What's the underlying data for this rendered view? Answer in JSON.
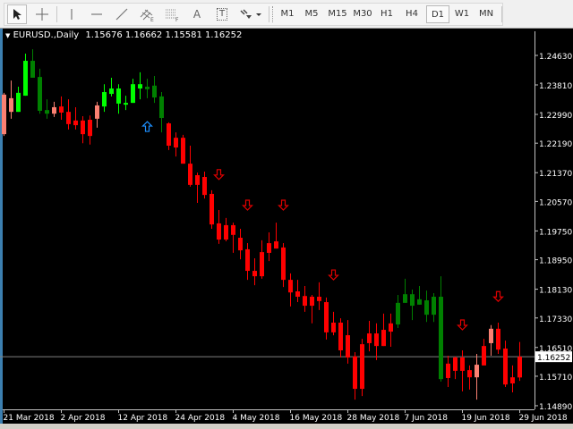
{
  "toolbar": {
    "tools": [
      {
        "name": "cursor-icon"
      },
      {
        "name": "crosshair-icon"
      },
      {
        "name": "vertical-line-icon"
      },
      {
        "name": "horizontal-line-icon"
      },
      {
        "name": "trendline-icon"
      },
      {
        "name": "equidistant-channel-icon"
      },
      {
        "name": "fibonacci-icon"
      },
      {
        "name": "text-icon",
        "label": "A"
      },
      {
        "name": "text-label-icon",
        "label": "T"
      },
      {
        "name": "arrows-icon"
      }
    ],
    "timeframes": [
      "M1",
      "M5",
      "M15",
      "M30",
      "H1",
      "H4",
      "D1",
      "W1",
      "MN"
    ],
    "active_timeframe": "D1"
  },
  "chart": {
    "symbol": "EURUSD.,Daily",
    "ohlc": "1.15676 1.16662 1.15581 1.16252",
    "current_price": "1.16252",
    "colors": {
      "lime": "#00ff00",
      "dgreen": "#008000",
      "red": "#ff0000",
      "salmon": "#fa8072",
      "arrow_up": "#1e90ff",
      "arrow_down": "#e00000",
      "price_line": "#808080"
    }
  },
  "chart_data": {
    "type": "candlestick",
    "title": "EURUSD.,Daily",
    "ylim": [
      1.1475,
      1.254
    ],
    "y_ticks": [
      "1.24630",
      "1.23810",
      "1.22990",
      "1.22190",
      "1.21370",
      "1.20570",
      "1.19750",
      "1.18950",
      "1.18130",
      "1.17330",
      "1.16510",
      "1.15710",
      "1.14890"
    ],
    "x_ticks": [
      {
        "bar": 0,
        "label": "21 Mar 2018"
      },
      {
        "bar": 8,
        "label": "2 Apr 2018"
      },
      {
        "bar": 16,
        "label": "12 Apr 2018"
      },
      {
        "bar": 24,
        "label": "24 Apr 2018"
      },
      {
        "bar": 32,
        "label": "4 May 2018"
      },
      {
        "bar": 40,
        "label": "16 May 2018"
      },
      {
        "bar": 48,
        "label": "28 May 2018"
      },
      {
        "bar": 56,
        "label": "7 Jun 2018"
      },
      {
        "bar": 64,
        "label": "19 Jun 2018"
      },
      {
        "bar": 72,
        "label": "29 Jun 2018"
      }
    ],
    "candles": [
      [
        1.2244,
        1.2359,
        1.2239,
        1.2354,
        "salmon"
      ],
      [
        1.2306,
        1.2393,
        1.2287,
        1.2344,
        "salmon"
      ],
      [
        1.2306,
        1.2376,
        1.2306,
        1.2359,
        "lime"
      ],
      [
        1.2351,
        1.2468,
        1.2351,
        1.2448,
        "lime"
      ],
      [
        1.2448,
        1.248,
        1.2401,
        1.2401,
        "dgreen"
      ],
      [
        1.2403,
        1.2426,
        1.2301,
        1.2309,
        "dgreen"
      ],
      [
        1.2311,
        1.2341,
        1.2287,
        1.2301,
        "dgreen"
      ],
      [
        1.2301,
        1.2334,
        1.2292,
        1.2319,
        "salmon"
      ],
      [
        1.2321,
        1.2349,
        1.2284,
        1.2304,
        "red"
      ],
      [
        1.2306,
        1.2341,
        1.2257,
        1.2272,
        "red"
      ],
      [
        1.2282,
        1.2319,
        1.2257,
        1.2269,
        "red"
      ],
      [
        1.2282,
        1.2294,
        1.2219,
        1.2244,
        "red"
      ],
      [
        1.2284,
        1.2296,
        1.2215,
        1.2239,
        "red"
      ],
      [
        1.2287,
        1.2334,
        1.2262,
        1.2324,
        "salmon"
      ],
      [
        1.2321,
        1.2383,
        1.2306,
        1.2361,
        "lime"
      ],
      [
        1.2356,
        1.2401,
        1.2349,
        1.2371,
        "lime"
      ],
      [
        1.2329,
        1.2383,
        1.2301,
        1.2371,
        "lime"
      ],
      [
        1.2326,
        1.2351,
        1.2311,
        1.2331,
        "lime"
      ],
      [
        1.2331,
        1.2398,
        1.2331,
        1.2383,
        "lime"
      ],
      [
        1.2371,
        1.2416,
        1.2341,
        1.2383,
        "lime"
      ],
      [
        1.2376,
        1.2398,
        1.2344,
        1.2369,
        "dgreen"
      ],
      [
        1.2379,
        1.2406,
        1.2331,
        1.2346,
        "dgreen"
      ],
      [
        1.2349,
        1.2361,
        1.2249,
        1.2289,
        "dgreen"
      ],
      [
        1.2274,
        1.2277,
        1.22,
        1.2212,
        "red"
      ],
      [
        1.2234,
        1.2249,
        1.2182,
        1.2207,
        "red"
      ],
      [
        1.2234,
        1.2242,
        1.2162,
        1.2162,
        "red"
      ],
      [
        1.2162,
        1.2212,
        1.2098,
        1.2103,
        "red"
      ],
      [
        1.213,
        1.2137,
        1.2053,
        1.2103,
        "red"
      ],
      [
        1.2125,
        1.214,
        1.2065,
        1.2075,
        "red"
      ],
      [
        1.2078,
        1.2088,
        1.1981,
        1.1993,
        "red"
      ],
      [
        1.1996,
        1.2033,
        1.1939,
        1.1951,
        "red"
      ],
      [
        1.1991,
        1.2011,
        1.1946,
        1.1951,
        "red"
      ],
      [
        1.1991,
        1.1998,
        1.1914,
        1.1964,
        "red"
      ],
      [
        1.1956,
        1.1981,
        1.1896,
        1.1921,
        "red"
      ],
      [
        1.1924,
        1.1941,
        1.1839,
        1.1864,
        "red"
      ],
      [
        1.1864,
        1.1899,
        1.1824,
        1.1849,
        "red"
      ],
      [
        1.1916,
        1.1949,
        1.1842,
        1.1849,
        "red"
      ],
      [
        1.1941,
        1.1971,
        1.1891,
        1.1914,
        "red"
      ],
      [
        1.1946,
        1.1998,
        1.1926,
        1.1926,
        "red"
      ],
      [
        1.1929,
        1.1941,
        1.1819,
        1.1839,
        "red"
      ],
      [
        1.1839,
        1.1857,
        1.1765,
        1.1804,
        "red"
      ],
      [
        1.1807,
        1.1839,
        1.1777,
        1.1792,
        "red"
      ],
      [
        1.1794,
        1.1822,
        1.175,
        1.1767,
        "red"
      ],
      [
        1.1792,
        1.1797,
        1.1718,
        1.1767,
        "red"
      ],
      [
        1.1792,
        1.1832,
        1.1755,
        1.178,
        "red"
      ],
      [
        1.1777,
        1.179,
        1.1673,
        1.1693,
        "red"
      ],
      [
        1.172,
        1.175,
        1.1685,
        1.1693,
        "red"
      ],
      [
        1.172,
        1.1732,
        1.1623,
        1.1643,
        "red"
      ],
      [
        1.1685,
        1.1727,
        1.1606,
        1.1623,
        "red"
      ],
      [
        1.1626,
        1.1638,
        1.1506,
        1.1536,
        "red"
      ],
      [
        1.166,
        1.1675,
        1.1516,
        1.1536,
        "red"
      ],
      [
        1.169,
        1.1725,
        1.164,
        1.1663,
        "red"
      ],
      [
        1.169,
        1.1718,
        1.1616,
        1.1655,
        "red"
      ],
      [
        1.17,
        1.1745,
        1.1655,
        1.1655,
        "red"
      ],
      [
        1.1718,
        1.1745,
        1.1653,
        1.1695,
        "red"
      ],
      [
        1.1775,
        1.1797,
        1.1705,
        1.1715,
        "dgreen"
      ],
      [
        1.1799,
        1.1842,
        1.1775,
        1.1775,
        "dgreen"
      ],
      [
        1.1799,
        1.1812,
        1.1727,
        1.1767,
        "dgreen"
      ],
      [
        1.1785,
        1.1822,
        1.177,
        1.177,
        "dgreen"
      ],
      [
        1.1782,
        1.1809,
        1.1722,
        1.1742,
        "dgreen"
      ],
      [
        1.1792,
        1.1802,
        1.1722,
        1.1742,
        "dgreen"
      ],
      [
        1.1792,
        1.1849,
        1.1556,
        1.1563,
        "dgreen"
      ],
      [
        1.1606,
        1.1628,
        1.1541,
        1.1566,
        "red"
      ],
      [
        1.1623,
        1.1626,
        1.1563,
        1.1586,
        "red"
      ],
      [
        1.1623,
        1.1643,
        1.1529,
        1.1586,
        "red"
      ],
      [
        1.1588,
        1.1601,
        1.1534,
        1.1568,
        "red"
      ],
      [
        1.1568,
        1.1633,
        1.1506,
        1.1603,
        "salmon"
      ],
      [
        1.1655,
        1.1675,
        1.1601,
        1.1601,
        "red"
      ],
      [
        1.1663,
        1.1713,
        1.1628,
        1.1703,
        "salmon"
      ],
      [
        1.1703,
        1.172,
        1.1633,
        1.1645,
        "red"
      ],
      [
        1.1648,
        1.167,
        1.1541,
        1.1548,
        "red"
      ],
      [
        1.1568,
        1.1601,
        1.1526,
        1.1551,
        "red"
      ],
      [
        1.15676,
        1.16662,
        1.15581,
        1.16252,
        "red"
      ]
    ],
    "arrows": [
      {
        "bar": 20,
        "price": 1.2264,
        "dir": "up"
      },
      {
        "bar": 30,
        "price": 1.2133,
        "dir": "down"
      },
      {
        "bar": 34,
        "price": 1.2048,
        "dir": "down"
      },
      {
        "bar": 39,
        "price": 1.2048,
        "dir": "down"
      },
      {
        "bar": 46,
        "price": 1.1854,
        "dir": "down"
      },
      {
        "bar": 64,
        "price": 1.1715,
        "dir": "down"
      },
      {
        "bar": 69,
        "price": 1.1794,
        "dir": "down"
      }
    ]
  }
}
